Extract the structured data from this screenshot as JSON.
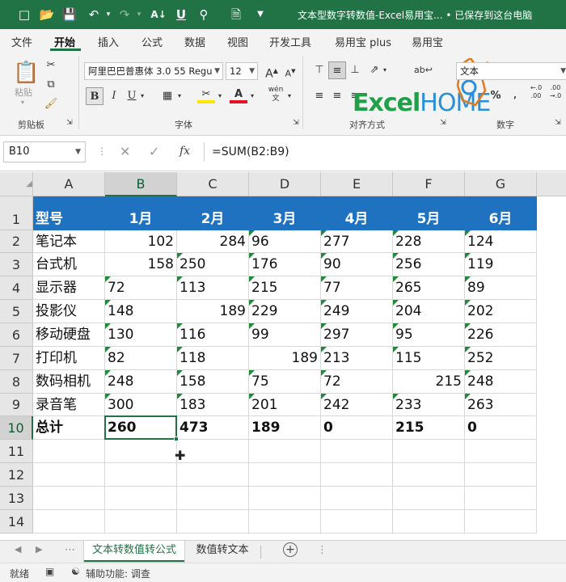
{
  "titlebar": {
    "title": "文本型数字转数值-Excel易用宝... • 已保存到这台电脑",
    "icons": [
      "file-icon",
      "open-icon",
      "save-icon",
      "undo-icon",
      "redo-icon",
      "sort-icon",
      "underline-icon",
      "search-icon",
      "doc-icon",
      "qat-more-icon"
    ]
  },
  "ribbon_tabs": [
    "文件",
    "开始",
    "插入",
    "公式",
    "数据",
    "视图",
    "开发工具",
    "易用宝 plus",
    "易用宝"
  ],
  "ribbon": {
    "paste_label": "粘贴",
    "clipboard_label": "剪贴板",
    "font_name": "阿里巴巴普惠体 3.0 55 Regu",
    "font_size": "12",
    "font_label": "字体",
    "align_label": "对齐方式",
    "number_format": "文本",
    "number_label": "数字",
    "bold": "B",
    "italic": "I",
    "underline": "U",
    "wen": "wén",
    "logo_text": "ExcelHOME"
  },
  "formula_bar": {
    "name_box": "B10",
    "formula": "=SUM(B2:B9)",
    "fx": "fx"
  },
  "grid": {
    "columns": [
      "A",
      "B",
      "C",
      "D",
      "E",
      "F",
      "G"
    ],
    "rows": [
      "1",
      "2",
      "3",
      "4",
      "5",
      "6",
      "7",
      "8",
      "9",
      "10",
      "11",
      "12",
      "13",
      "14"
    ],
    "header_row": [
      "型号",
      "1月",
      "2月",
      "3月",
      "4月",
      "5月",
      "6月"
    ],
    "data": [
      [
        "笔记本",
        "102",
        "284",
        "96",
        "277",
        "228",
        "124"
      ],
      [
        "台式机",
        "158",
        "250",
        "176",
        "90",
        "256",
        "119"
      ],
      [
        "显示器",
        "72",
        "113",
        "215",
        "77",
        "265",
        "89"
      ],
      [
        "投影仪",
        "148",
        "189",
        "229",
        "249",
        "204",
        "202"
      ],
      [
        "移动硬盘",
        "130",
        "116",
        "99",
        "297",
        "95",
        "226"
      ],
      [
        "打印机",
        "82",
        "118",
        "189",
        "213",
        "115",
        "252"
      ],
      [
        "数码相机",
        "248",
        "158",
        "75",
        "72",
        "215",
        "248"
      ],
      [
        "录音笔",
        "300",
        "183",
        "201",
        "242",
        "233",
        "263"
      ]
    ],
    "number_cells": [
      [
        0,
        1
      ],
      [
        0,
        2
      ],
      [
        1,
        1
      ],
      [
        3,
        2
      ],
      [
        5,
        3
      ],
      [
        6,
        5
      ]
    ],
    "total_row": [
      "总计",
      "260",
      "473",
      "189",
      "0",
      "215",
      "0"
    ],
    "selected_cell": "B10"
  },
  "sheet_tabs": [
    "文本转数值转公式",
    "数值转文本"
  ],
  "status": {
    "ready": "就绪",
    "accessibility": "辅助功能: 调查"
  },
  "colors": {
    "excel_green": "#217346",
    "header_blue": "#1e72c0",
    "text_marker_green": "#1f8a3a"
  }
}
